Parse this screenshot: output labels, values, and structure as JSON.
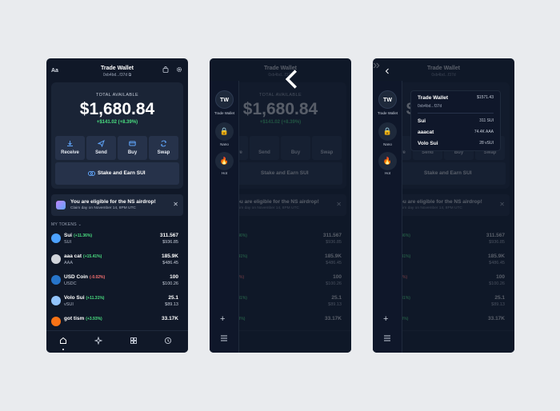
{
  "wallet": {
    "name": "Trade Wallet",
    "address": "0xb4bd...f37d",
    "lang": "Aa",
    "total_label": "TOTAL AVAILABLE",
    "total": "$1,680.84",
    "change": "+$141.02 (+8.39%)"
  },
  "actions": {
    "receive": "Receive",
    "send": "Send",
    "buy": "Buy",
    "swap": "Swap",
    "stake": "Stake and Earn SUI"
  },
  "banner": {
    "title": "You are eligible for the NS airdrop!",
    "subtitle": "Claim day on November 14, 8PM UTC"
  },
  "tokens_label": "MY TOKENS",
  "tokens": [
    {
      "name": "Sui",
      "pct": "(+11.36%)",
      "symbol": "SUI",
      "amount": "311.567",
      "usd": "$936.85",
      "color": "#4da2ff",
      "dir": "up"
    },
    {
      "name": "aaa cat",
      "pct": "(+15.41%)",
      "symbol": "AAA",
      "amount": "185.9K",
      "usd": "$486.45",
      "color": "#d1d5db",
      "dir": "up"
    },
    {
      "name": "USD Coin",
      "pct": "(-0.02%)",
      "symbol": "USDC",
      "amount": "100",
      "usd": "$100.26",
      "color": "#2775ca",
      "dir": "down"
    },
    {
      "name": "Volo Sui",
      "pct": "(+11.31%)",
      "symbol": "vSUI",
      "amount": "25.1",
      "usd": "$89.13",
      "color": "#93c5fd",
      "dir": "up"
    },
    {
      "name": "got tism",
      "pct": "(+3.93%)",
      "symbol": "TISM",
      "amount": "33.17K",
      "usd": "$28.37",
      "color": "#f97316",
      "dir": "up"
    }
  ],
  "nav": [
    "home-icon",
    "sparkle-icon",
    "grid-icon",
    "history-icon"
  ],
  "rail": {
    "wallet_initials": "TW",
    "wallet_label": "Trade Wallet",
    "nano_label": "Nano",
    "hot_label": "Hot"
  },
  "popup": {
    "title": "Trade Wallet",
    "total": "$1571.43",
    "address": "0xb4bd...f37d",
    "rows": [
      {
        "name": "Sui",
        "value": "311 SUI"
      },
      {
        "name": "aaacat",
        "value": "74.4K AAA"
      },
      {
        "name": "Volo Sui",
        "value": "28 vSUI"
      }
    ]
  }
}
